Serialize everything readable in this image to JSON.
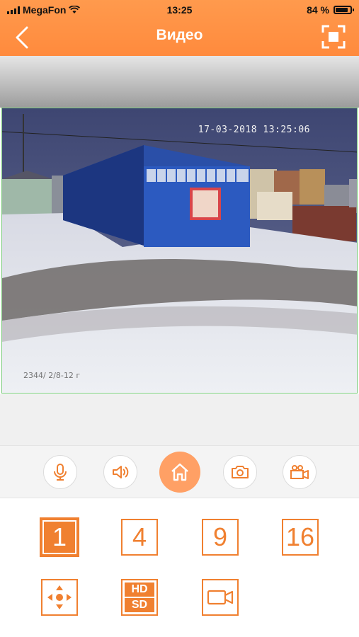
{
  "status_bar": {
    "carrier": "MegaFon",
    "time": "13:25",
    "battery_percent": "84 %",
    "battery_level": 0.84
  },
  "header": {
    "title": "Видео",
    "back_icon": "chevron-left-icon",
    "fullscreen_icon": "fullscreen-icon"
  },
  "video": {
    "timestamp": "17-03-2018 13:25:06",
    "camera_label": "2344/ 2/8-12 г"
  },
  "controls": [
    {
      "name": "microphone-button",
      "icon": "microphone-icon"
    },
    {
      "name": "speaker-button",
      "icon": "speaker-icon"
    },
    {
      "name": "home-button",
      "icon": "home-icon"
    },
    {
      "name": "snapshot-button",
      "icon": "camera-icon"
    },
    {
      "name": "record-button",
      "icon": "video-camera-icon"
    }
  ],
  "layout_buttons": [
    {
      "label": "1",
      "active": true
    },
    {
      "label": "4",
      "active": false
    },
    {
      "label": "9",
      "active": false
    },
    {
      "label": "16",
      "active": false
    }
  ],
  "extra_buttons": {
    "ptz_icon": "ptz-arrows-icon",
    "quality_hd": "HD",
    "quality_sd": "SD",
    "record_icon": "video-record-icon"
  },
  "colors": {
    "accent": "#f08030",
    "header": "#ff8f42",
    "home_button": "#ffa065"
  }
}
